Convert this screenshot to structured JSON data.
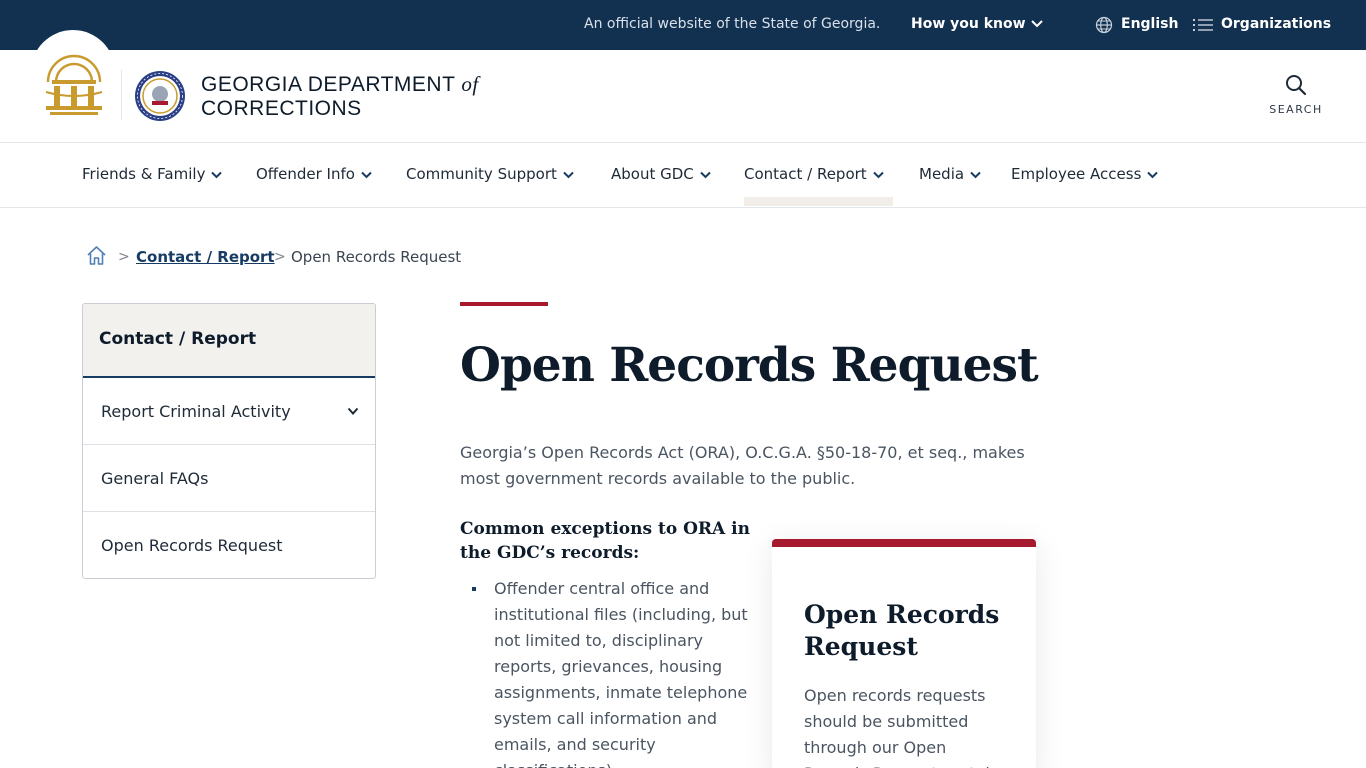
{
  "topbar": {
    "official_text": "An official website of the State of Georgia.",
    "how_you_know": "How you know",
    "language": "English",
    "organizations": "Organizations"
  },
  "header": {
    "title_line1": "GEORGIA DEPARTMENT",
    "title_of": "of",
    "title_line2": "CORRECTIONS",
    "search_label": "SEARCH"
  },
  "nav": {
    "items": [
      {
        "label": "Friends & Family"
      },
      {
        "label": "Offender Info"
      },
      {
        "label": "Community Support"
      },
      {
        "label": "About GDC"
      },
      {
        "label": "Contact / Report"
      },
      {
        "label": "Media"
      },
      {
        "label": "Employee Access"
      }
    ],
    "active": "Contact / Report"
  },
  "breadcrumb": {
    "separator": ">",
    "parent": "Contact / Report",
    "current": "Open Records Request"
  },
  "sidebar": {
    "heading": "Contact / Report",
    "items": [
      {
        "label": "Report Criminal Activity"
      },
      {
        "label": "General FAQs"
      },
      {
        "label": "Open Records Request"
      }
    ]
  },
  "content": {
    "title": "Open Records Request",
    "intro": "Georgia’s Open Records Act (ORA), O.C.G.A. §50-18-70, et seq., makes most government records available to the public.",
    "exceptions_heading": "Common exceptions to ORA in the GDC’s records:",
    "exceptions": [
      "Offender central office and institutional files (including, but not limited to, disciplinary reports, grievances, housing assignments, inmate telephone system call information and emails, and security classifications);"
    ]
  },
  "card": {
    "title": "Open Records Request",
    "text": "Open records requests should be submitted through our Open Records Request portal."
  },
  "colors": {
    "topbar_bg": "#12304f",
    "accent_red": "#a6192e",
    "link_navy": "#163c63",
    "seal_gold": "#c99a2e"
  }
}
